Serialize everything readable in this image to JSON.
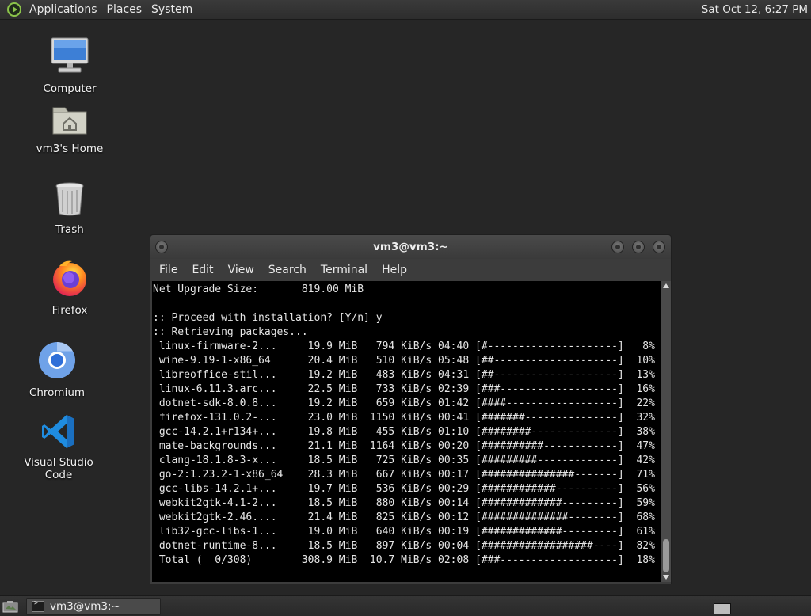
{
  "top_panel": {
    "menus": [
      "Applications",
      "Places",
      "System"
    ],
    "clock": "Sat Oct 12,  6:27 PM"
  },
  "desktop": {
    "icons": [
      {
        "label": "Computer",
        "icon": "computer-icon"
      },
      {
        "label": "vm3's Home",
        "icon": "home-folder-icon"
      },
      {
        "label": "Trash",
        "icon": "trash-icon"
      },
      {
        "label": "Firefox",
        "icon": "firefox-icon"
      },
      {
        "label": "Chromium",
        "icon": "chromium-icon"
      },
      {
        "label": "Visual Studio Code",
        "icon": "vscode-icon"
      }
    ]
  },
  "terminal": {
    "title": "vm3@vm3:~",
    "menus": [
      "File",
      "Edit",
      "View",
      "Search",
      "Terminal",
      "Help"
    ],
    "lines": [
      "Net Upgrade Size:       819.00 MiB",
      "",
      ":: Proceed with installation? [Y/n] y",
      ":: Retrieving packages...",
      " linux-firmware-2...     19.9 MiB   794 KiB/s 04:40 [#---------------------]   8%",
      " wine-9.19-1-x86_64      20.4 MiB   510 KiB/s 05:48 [##--------------------]  10%",
      " libreoffice-stil...     19.2 MiB   483 KiB/s 04:31 [##--------------------]  13%",
      " linux-6.11.3.arc...     22.5 MiB   733 KiB/s 02:39 [###-------------------]  16%",
      " dotnet-sdk-8.0.8...     19.2 MiB   659 KiB/s 01:42 [####------------------]  22%",
      " firefox-131.0.2-...     23.0 MiB  1150 KiB/s 00:41 [#######---------------]  32%",
      " gcc-14.2.1+r134+...     19.8 MiB   455 KiB/s 01:10 [########--------------]  38%",
      " mate-backgrounds...     21.1 MiB  1164 KiB/s 00:20 [##########------------]  47%",
      " clang-18.1.8-3-x...     18.5 MiB   725 KiB/s 00:35 [#########-------------]  42%",
      " go-2:1.23.2-1-x86_64    28.3 MiB   667 KiB/s 00:17 [###############-------]  71%",
      " gcc-libs-14.2.1+...     19.7 MiB   536 KiB/s 00:29 [############----------]  56%",
      " webkit2gtk-4.1-2...     18.5 MiB   880 KiB/s 00:14 [#############---------]  59%",
      " webkit2gtk-2.46....     21.4 MiB   825 KiB/s 00:12 [##############--------]  68%",
      " lib32-gcc-libs-1...     19.0 MiB   640 KiB/s 00:19 [#############---------]  61%",
      " dotnet-runtime-8...     18.5 MiB   897 KiB/s 00:04 [##################----]  82%",
      " Total (  0/308)        308.9 MiB  10.7 MiB/s 02:08 [###-------------------]  18%"
    ]
  },
  "taskbar": {
    "task_label": "vm3@vm3:~"
  }
}
